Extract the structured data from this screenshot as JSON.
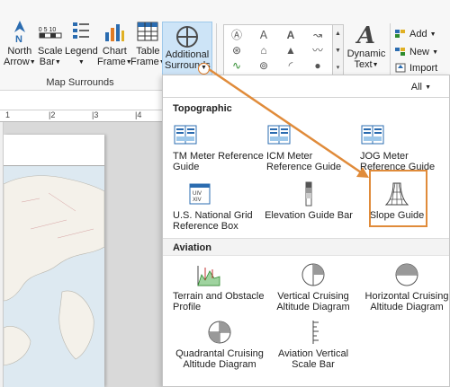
{
  "ribbon": {
    "group_label": "Map Surrounds",
    "buttons": [
      {
        "name": "north-arrow",
        "line1": "North",
        "line2": "Arrow"
      },
      {
        "name": "scale-bar",
        "line1": "Scale",
        "line2": "Bar"
      },
      {
        "name": "legend",
        "line1": "Legend",
        "line2": ""
      },
      {
        "name": "chart-frame",
        "line1": "Chart",
        "line2": "Frame"
      },
      {
        "name": "table-frame",
        "line1": "Table",
        "line2": "Frame"
      }
    ],
    "scale_bar_digits": "0 5 10",
    "additional_surrounds": {
      "line1": "Additional",
      "line2": "Surrounds"
    },
    "dynamic_text": {
      "line1": "Dynamic",
      "line2": "Text"
    },
    "add": "Add",
    "new": "New",
    "import": "Import",
    "chevron": "⌄"
  },
  "ruler": {
    "numbers": [
      "1",
      "|2",
      "|3",
      "|4"
    ]
  },
  "panel": {
    "filter": "All",
    "topographic": {
      "heading": "Topographic",
      "items": [
        "TM Meter Reference Guide",
        "ICM Meter Reference Guide",
        "JOG Meter Reference Guide",
        "U.S. National Grid Reference Box",
        "Elevation Guide Bar",
        "Slope Guide"
      ]
    },
    "aviation": {
      "heading": "Aviation",
      "items": [
        "Terrain and Obstacle Profile",
        "Vertical Cruising Altitude Diagram",
        "Horizontal Cruising Altitude Diagram",
        "Quadrantal Cruising Altitude Diagram",
        "Aviation Vertical Scale Bar"
      ]
    },
    "usng_box_text": "UIV XIV"
  },
  "colors": {
    "accent": "#e08b3a",
    "selected": "#cde4f7",
    "blue_icon": "#2b6cb0"
  }
}
